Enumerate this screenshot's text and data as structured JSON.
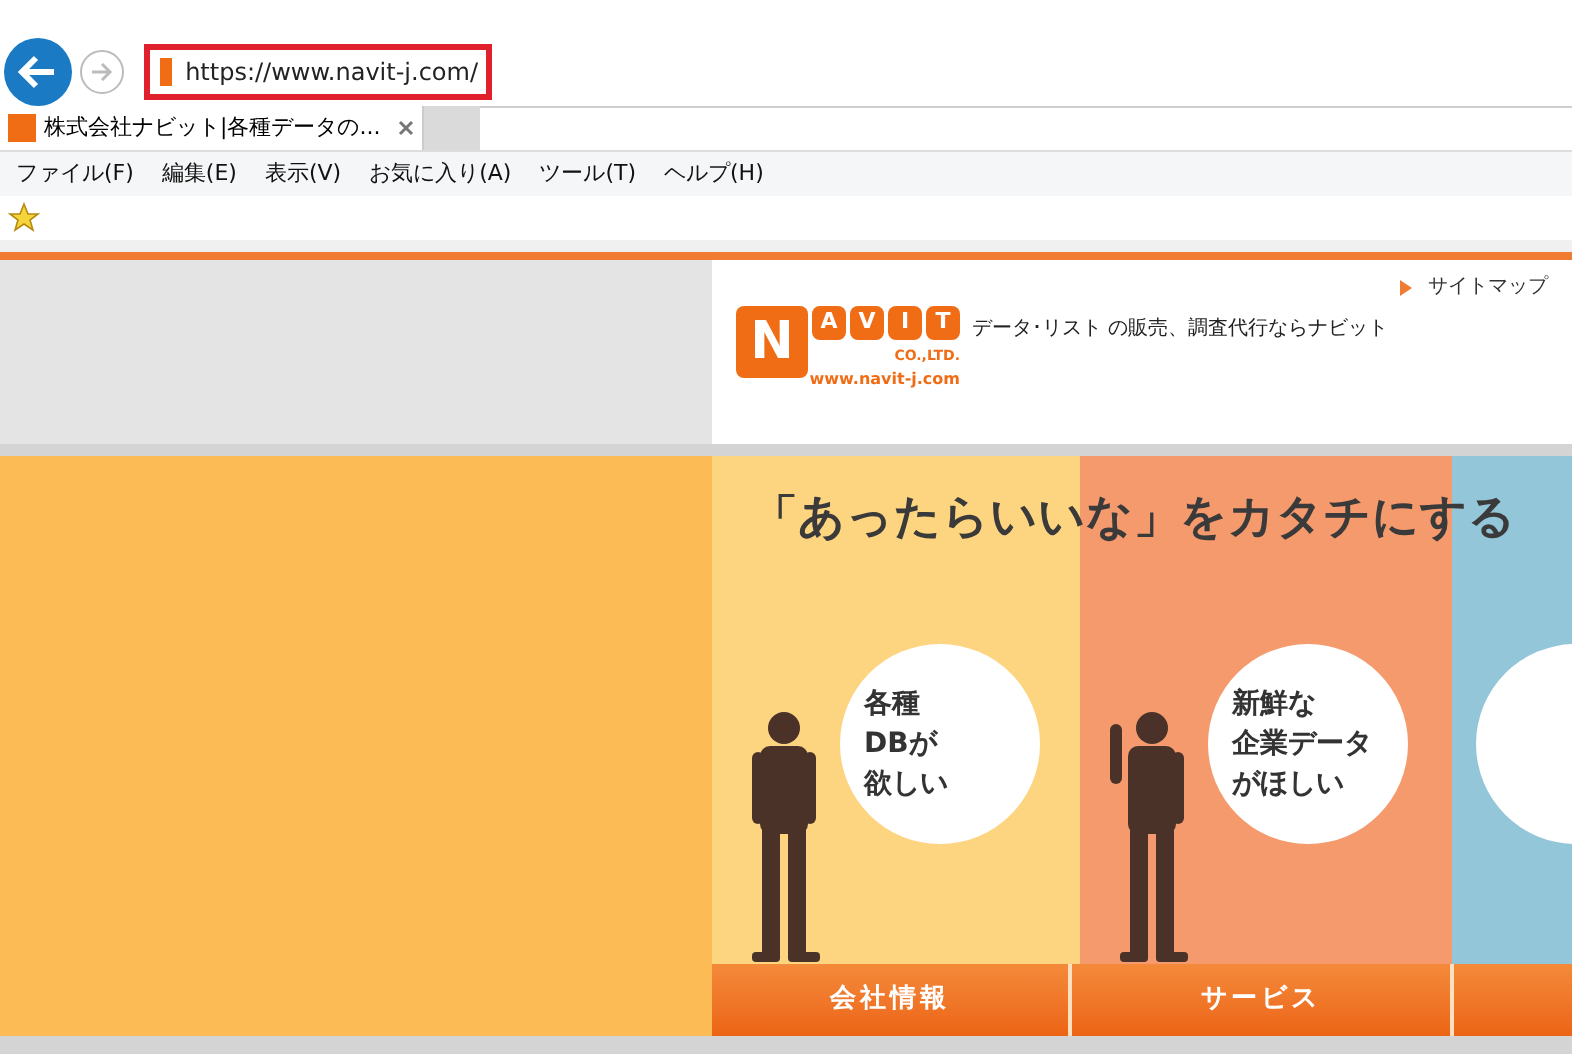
{
  "browser": {
    "address": "https://www.navit-j.com/",
    "tabs": [
      {
        "title": "株式会社ナビット|各種データの...",
        "selected": true
      }
    ],
    "menu": [
      "ファイル(F)",
      "編集(E)",
      "表示(V)",
      "お気に入り(A)",
      "ツール(T)",
      "ヘルプ(H)"
    ]
  },
  "header": {
    "logo_letters": [
      "N",
      "A",
      "V",
      "I",
      "T"
    ],
    "logo_company": "CO.,LTD.",
    "logo_url": "www.navit-j.com",
    "tagline": "データ･リスト の販売、調査代行ならナビット",
    "sitemap": "サイトマップ"
  },
  "banner": {
    "headline": "「あったらいいな」をカタチにする",
    "panels": [
      {
        "color": "#fdd480",
        "figure": true,
        "bubble_lines": [
          "各種",
          "DBが",
          "欲しい"
        ]
      },
      {
        "color": "#f59a6d",
        "figure": true,
        "bubble_lines": [
          "新鮮な",
          "企業データ",
          "がほしい"
        ]
      },
      {
        "color": "#94c6d9",
        "figure": false
      }
    ],
    "nav": [
      "会社情報",
      "サービス"
    ]
  }
}
